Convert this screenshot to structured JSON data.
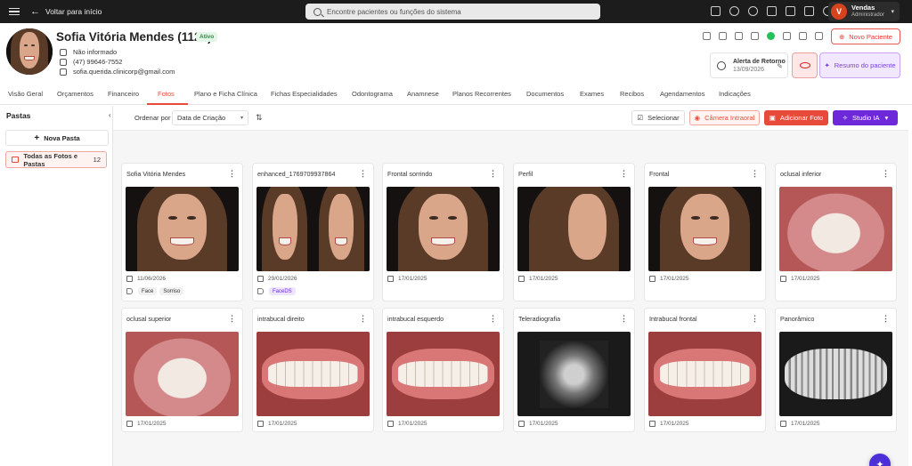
{
  "topbar": {
    "back_label": "Voltar para início",
    "search_placeholder": "Encontre pacientes ou funções do sistema",
    "user": {
      "initial": "V",
      "name": "Vendas",
      "role": "Administrador"
    }
  },
  "patient": {
    "name": "Sofia Vitória Mendes (1120)",
    "status": "Ativo",
    "info": [
      "Não informado",
      "(47) 99646-7552",
      "sofia.querida.clinicorp@gmail.com"
    ],
    "alert_title": "Alerta de Retorno",
    "alert_date": "13/09/2026",
    "new_patient_label": "Novo Paciente",
    "summary_label": "Resumo do paciente"
  },
  "tabs": [
    "Visão Geral",
    "Orçamentos",
    "Financeiro",
    "Fotos",
    "Plano e Ficha Clínica",
    "Fichas Especialidades",
    "Odontograma",
    "Anamnese",
    "Planos Recorrentes",
    "Documentos",
    "Exames",
    "Recibos",
    "Agendamentos",
    "Indicações"
  ],
  "active_tab": "Fotos",
  "sidebar": {
    "title": "Pastas",
    "new_folder_label": "Nova Pasta",
    "all_label": "Todas as Fotos e Pastas",
    "all_count": "12"
  },
  "toolbar": {
    "order_label": "Ordenar por",
    "order_value": "Data de Criação",
    "select_label": "Selecionar",
    "camera_label": "Câmera Intraoral",
    "add_label": "Adicionar Foto",
    "studio_label": "Studio IA"
  },
  "photos": [
    {
      "title": "Sofia Vitória Mendes",
      "date": "11/06/2026",
      "tags": [
        "Face",
        "Sorriso"
      ],
      "kind": "face"
    },
    {
      "title": "enhanced_1769709937864",
      "date": "29/01/2026",
      "tags": [
        "FaceDS"
      ],
      "kind": "face2"
    },
    {
      "title": "Frontal sorrindo",
      "date": "17/01/2025",
      "tags": [],
      "kind": "face"
    },
    {
      "title": "Perfil",
      "date": "17/01/2025",
      "tags": [],
      "kind": "profile"
    },
    {
      "title": "Frontal",
      "date": "17/01/2025",
      "tags": [],
      "kind": "face"
    },
    {
      "title": "oclusal inferior",
      "date": "17/01/2025",
      "tags": [],
      "kind": "occlusal"
    },
    {
      "title": "oclusal superior",
      "date": "17/01/2025",
      "tags": [],
      "kind": "occlusal"
    },
    {
      "title": "intrabucal direito",
      "date": "17/01/2025",
      "tags": [],
      "kind": "teeth"
    },
    {
      "title": "intrabucal esquerdo",
      "date": "17/01/2025",
      "tags": [],
      "kind": "teeth"
    },
    {
      "title": "Teleradiografia",
      "date": "17/01/2025",
      "tags": [],
      "kind": "xray"
    },
    {
      "title": "Intrabucal frontal",
      "date": "17/01/2025",
      "tags": [],
      "kind": "teeth"
    },
    {
      "title": "Panorâmico",
      "date": "17/01/2025",
      "tags": [],
      "kind": "pano"
    }
  ],
  "colors": {
    "accent": "#e84a3a",
    "studio": "#6d28d9",
    "active_green": "#2a8c47"
  }
}
